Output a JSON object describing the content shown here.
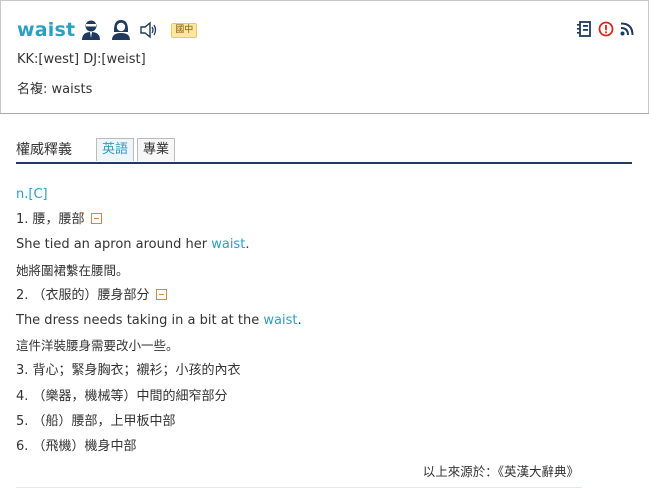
{
  "header": {
    "word": "waist",
    "level_badge": "國中",
    "pronunciation": "KK:[west] DJ:[weist]",
    "plural": "名複: waists",
    "icons": [
      "male-voice-icon",
      "female-voice-icon",
      "speaker-icon",
      "wordbook-icon",
      "report-icon",
      "rss-icon"
    ]
  },
  "section": {
    "title": "權威釋義",
    "tabs": [
      {
        "label": "英語",
        "active": true
      },
      {
        "label": "專業",
        "active": false
      }
    ]
  },
  "entry": {
    "pos": "n.[C]",
    "senses": [
      {
        "label": "1. 腰，腰部",
        "example_en_before": "She tied an apron around her ",
        "example_en_keyword": "waist",
        "example_en_after": ".",
        "example_zh": "她將圍裙繫在腰間。"
      },
      {
        "label": "2. （衣服的）腰身部分",
        "example_en_before": "The dress needs taking in a bit at the ",
        "example_en_keyword": "waist",
        "example_en_after": ".",
        "example_zh": "這件洋裝腰身需要改小一些。"
      },
      {
        "label": "3. 背心；緊身胸衣；襯衫；小孩的內衣"
      },
      {
        "label": "4. （樂器，機械等）中間的細窄部分"
      },
      {
        "label": "5. （船）腰部，上甲板中部"
      },
      {
        "label": "6. （飛機）機身中部"
      }
    ],
    "source": "以上來源於：《英漢大辭典》"
  },
  "colors": {
    "accent": "#2aa0c2",
    "navy": "#1f3a5e",
    "badge_bg": "#fde7a3",
    "alert_red": "#d9261c"
  }
}
